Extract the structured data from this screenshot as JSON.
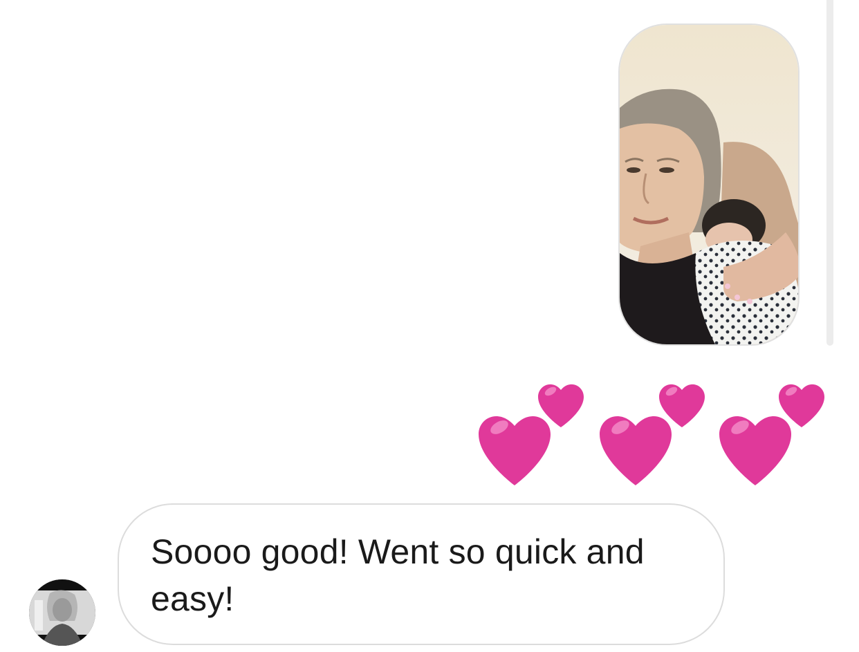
{
  "thread": {
    "photo_message": {
      "icon": "photo-woman-holding-newborn"
    },
    "hearts_message": {
      "icon": "two-hearts-emoji",
      "count": 3,
      "color": "#e0399a"
    },
    "incoming_message": {
      "text": "Soooo good! Went so quick and easy!",
      "avatar_icon": "contact-avatar"
    }
  },
  "colors": {
    "bubble_border": "#dcdcdc",
    "heart_pink": "#e0399a",
    "scrollbar": "#ececec"
  }
}
